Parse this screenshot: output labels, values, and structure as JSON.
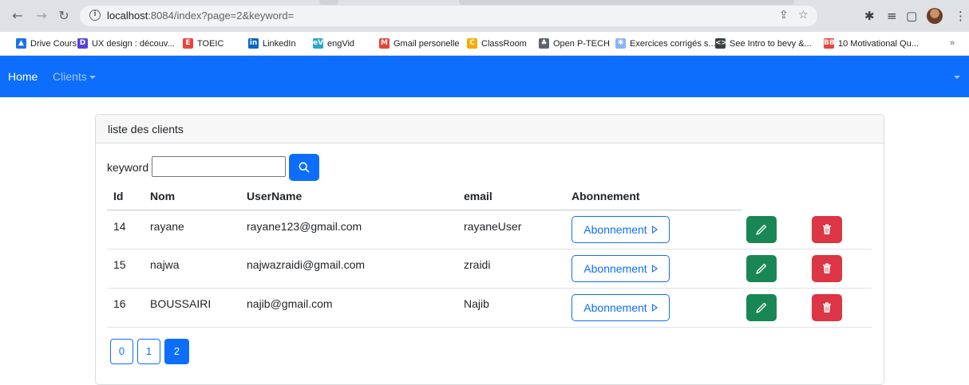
{
  "browser": {
    "url_host": "localhost",
    "url_rest": ":8084/index?page=2&keyword=",
    "bookmarks": [
      {
        "label": "Drive Cours",
        "color": "#1a73e8",
        "glyph": "▲"
      },
      {
        "label": "UX design : découv...",
        "color": "#5b3fd6",
        "glyph": "D"
      },
      {
        "label": "TOEIC",
        "color": "#e8453c",
        "glyph": "E"
      },
      {
        "label": "LinkedIn",
        "color": "#0a66c2",
        "glyph": "in"
      },
      {
        "label": "engVid",
        "color": "#2ba6cb",
        "glyph": "eV"
      },
      {
        "label": "Gmail personelle",
        "color": "#ea4335",
        "glyph": "M"
      },
      {
        "label": "ClassRoom",
        "color": "#f9ab00",
        "glyph": "C"
      },
      {
        "label": "Open P-TECH",
        "color": "#5f6368",
        "glyph": "♣"
      },
      {
        "label": "Exercices corrigés s...",
        "color": "#8ab4f8",
        "glyph": "✱"
      },
      {
        "label": "See Intro to bevy &...",
        "color": "#3c4043",
        "glyph": "<>"
      },
      {
        "label": "10 Motivational Qu...",
        "color": "#e8453c",
        "glyph": "BB"
      }
    ],
    "more_bookmarks": "»"
  },
  "navbar": {
    "home": "Home",
    "clients": "Clients"
  },
  "card": {
    "title": "liste des clients"
  },
  "search": {
    "label": "keyword",
    "value": ""
  },
  "table": {
    "headers": [
      "Id",
      "Nom",
      "UserName",
      "email",
      "Abonnement"
    ],
    "rows": [
      {
        "id": "14",
        "nom": "rayane",
        "username": "rayane123@gmail.com",
        "email": "rayaneUser",
        "action": "Abonnement"
      },
      {
        "id": "15",
        "nom": "najwa",
        "username": "najwazraidi@gmail.com",
        "email": "zraidi",
        "action": "Abonnement"
      },
      {
        "id": "16",
        "nom": "BOUSSAIRI",
        "username": "najib@gmail.com",
        "email": "Najib",
        "action": "Abonnement"
      }
    ]
  },
  "pagination": {
    "pages": [
      "0",
      "1",
      "2"
    ],
    "current": "2"
  },
  "colors": {
    "primary": "#0d6efd",
    "success": "#198754",
    "danger": "#dc3545"
  }
}
